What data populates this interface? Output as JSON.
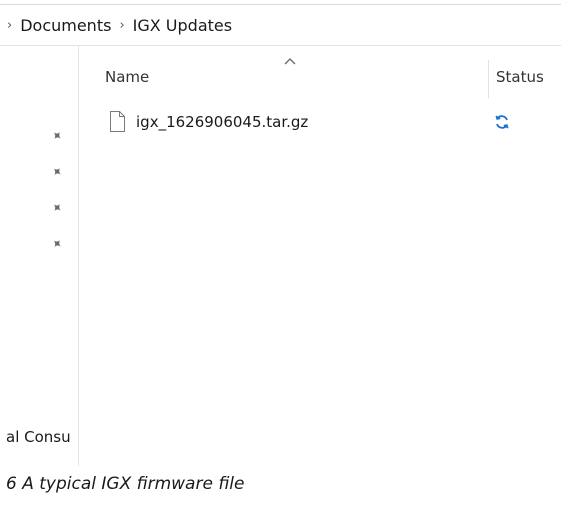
{
  "breadcrumb": {
    "items": [
      "Documents",
      "IGX Updates"
    ]
  },
  "columns": {
    "name": "Name",
    "status": "Status"
  },
  "files": [
    {
      "name": "igx_1626906045.tar.gz",
      "status_icon": "sync-icon"
    }
  ],
  "navpane": {
    "pinned_count": 4,
    "partial_label": "al Consu"
  },
  "caption": "6 A typical IGX firmware file",
  "colors": {
    "sync_icon": "#1f6fd1",
    "pin_icon": "#6b6b6b"
  }
}
